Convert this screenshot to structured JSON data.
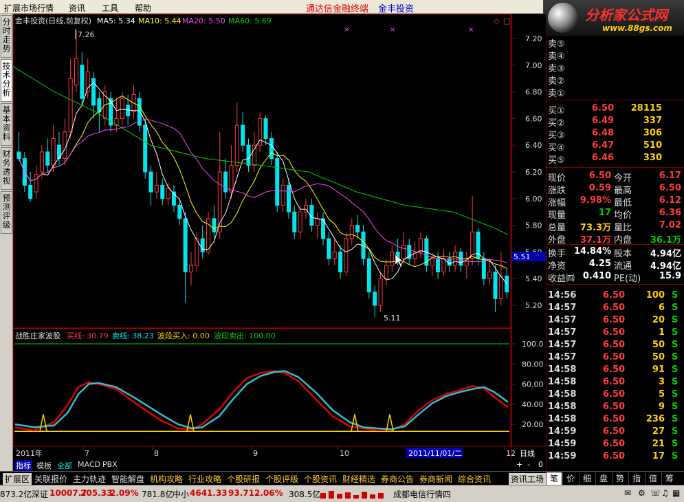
{
  "menu": {
    "items": [
      "扩展市场行情",
      "资讯",
      "工具",
      "帮助"
    ],
    "title1": "通达信金融终端",
    "title2": "金丰投资"
  },
  "logo": {
    "name": "分析家公式网",
    "url": "www.88gs.com"
  },
  "side_tabs": [
    "分时走势",
    "技术分析",
    "基本资料",
    "财务透视",
    "预测评级"
  ],
  "header": {
    "stock": "金丰投资(日线,前复权)",
    "ma5": "MA5: 5.34",
    "ma10": "MA10: 5.44",
    "ma20": "MA20: 5.50",
    "ma60": "MA60: 5.69"
  },
  "colors": {
    "up": "#ff3b3b",
    "down": "#00e5ee",
    "ma5": "#ffffff",
    "ma10": "#ffff00",
    "ma20": "#ff40ff",
    "ma60": "#00d000"
  },
  "price_axis": [
    "7.20",
    "7.00",
    "6.80",
    "6.60",
    "6.40",
    "6.20",
    "6.00",
    "5.80",
    "5.60",
    "5.40",
    "5.20"
  ],
  "high_label": "7.26",
  "low_label": "5.11",
  "current_tag": "5.51",
  "indicator": {
    "name": "战胜庄家波股",
    "buy": "买线: 30.79",
    "sell": "卖线: 38.23",
    "band_buy": "波段买入: 0.00",
    "band_sell": "波段卖出: 100.00",
    "axis": [
      "100.0",
      "80.00",
      "60.00",
      "40.00",
      "20.00"
    ]
  },
  "date_axis": {
    "labels": [
      "2011年",
      "7",
      "8",
      "9",
      "10",
      "11",
      "12"
    ],
    "cursor": "2011/11/01/二",
    "period": "日线",
    "controls": [
      "+",
      "-",
      "0"
    ]
  },
  "bottom_tabs": [
    "指标",
    "模板",
    "全部",
    "MACD",
    "PBX"
  ],
  "orderbook": {
    "sells": [
      "卖⑤",
      "卖④",
      "卖③",
      "卖②",
      "卖①"
    ],
    "buys": [
      {
        "l": "买①",
        "p": "6.50",
        "v": "28115"
      },
      {
        "l": "买②",
        "p": "6.49",
        "v": "337"
      },
      {
        "l": "买③",
        "p": "6.48",
        "v": "306"
      },
      {
        "l": "买④",
        "p": "6.47",
        "v": "510"
      },
      {
        "l": "买⑤",
        "p": "6.46",
        "v": "330"
      }
    ]
  },
  "quote": [
    {
      "a": "现价",
      "av": "6.50",
      "b": "今开",
      "bv": "6.17"
    },
    {
      "a": "涨跌",
      "av": "0.59",
      "b": "最高",
      "bv": "6.50"
    },
    {
      "a": "涨幅",
      "av": "9.98%",
      "b": "最低",
      "bv": "6.12"
    },
    {
      "a": "现量",
      "av": "17",
      "b": "均价",
      "bv": "6.36"
    },
    {
      "a": "总量",
      "av": "73.3万",
      "b": "量比",
      "bv": "7.02"
    },
    {
      "a": "外盘",
      "av": "37.1万",
      "b": "内盘",
      "bv": "36.1万"
    },
    {
      "a": "换手",
      "av": "14.84%",
      "b": "股本",
      "bv": "4.94亿"
    },
    {
      "a": "净资",
      "av": "4.25",
      "b": "流通",
      "bv": "4.94亿"
    },
    {
      "a": "收益㈣",
      "av": "0.410",
      "b": "PE(动)",
      "bv": "15.9"
    }
  ],
  "ticks": [
    {
      "t": "14:56",
      "p": "6.50",
      "v": "100",
      "s": "S"
    },
    {
      "t": "14:57",
      "p": "6.50",
      "v": "6",
      "s": "S"
    },
    {
      "t": "14:57",
      "p": "6.50",
      "v": "20",
      "s": "S"
    },
    {
      "t": "14:57",
      "p": "6.50",
      "v": "1",
      "s": "S"
    },
    {
      "t": "14:57",
      "p": "6.50",
      "v": "50",
      "s": "S"
    },
    {
      "t": "14:57",
      "p": "6.50",
      "v": "50",
      "s": "S"
    },
    {
      "t": "14:58",
      "p": "6.50",
      "v": "91",
      "s": "S"
    },
    {
      "t": "14:58",
      "p": "6.50",
      "v": "3",
      "s": "S"
    },
    {
      "t": "14:58",
      "p": "6.50",
      "v": "5",
      "s": "S"
    },
    {
      "t": "14:58",
      "p": "6.50",
      "v": "9",
      "s": "S"
    },
    {
      "t": "14:58",
      "p": "6.50",
      "v": "236",
      "s": "S"
    },
    {
      "t": "14:59",
      "p": "6.50",
      "v": "27",
      "s": "S"
    },
    {
      "t": "14:59",
      "p": "6.50",
      "v": "21",
      "s": "S"
    },
    {
      "t": "14:59",
      "p": "6.50",
      "v": "17",
      "s": "S"
    }
  ],
  "nav": [
    "扩展区",
    "关联报价",
    "主力轨迹",
    "智能解盘",
    "机构攻略",
    "行业攻略",
    "个股研报",
    "个股评级",
    "个股资讯",
    "财经精选",
    "券商公告",
    "券商新闻",
    "综合资讯",
    "资讯工场"
  ],
  "right_tabs": [
    "笔",
    "价",
    "细",
    "盘",
    "势",
    "指",
    "值",
    "筹"
  ],
  "status": {
    "s1": "873.2亿",
    "s2": "深证",
    "s3": "10007.7",
    "s4": "205.33",
    "s5": "2.09%",
    "s6": "781.8亿",
    "s7": "中小",
    "s8": "4641.33",
    "s9": "93.71",
    "s10": "2.06%",
    "s11": "308.5亿",
    "s12": "成都电信行情四"
  }
}
